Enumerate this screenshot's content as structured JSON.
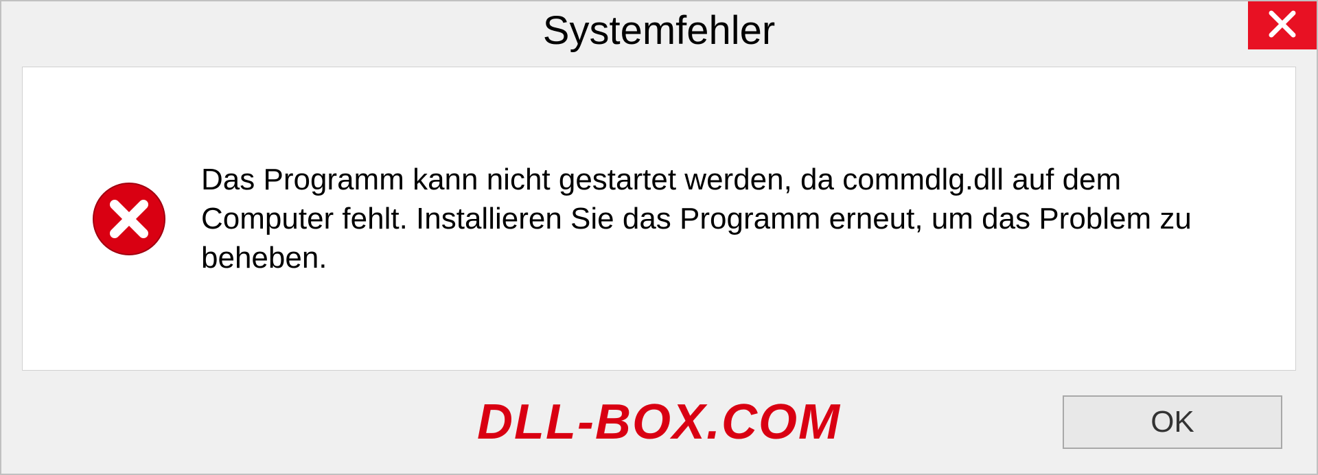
{
  "dialog": {
    "title": "Systemfehler",
    "message": "Das Programm kann nicht gestartet werden, da commdlg.dll auf dem Computer fehlt. Installieren Sie das Programm erneut, um das Problem zu beheben.",
    "ok_label": "OK"
  },
  "watermark": "DLL-BOX.COM"
}
